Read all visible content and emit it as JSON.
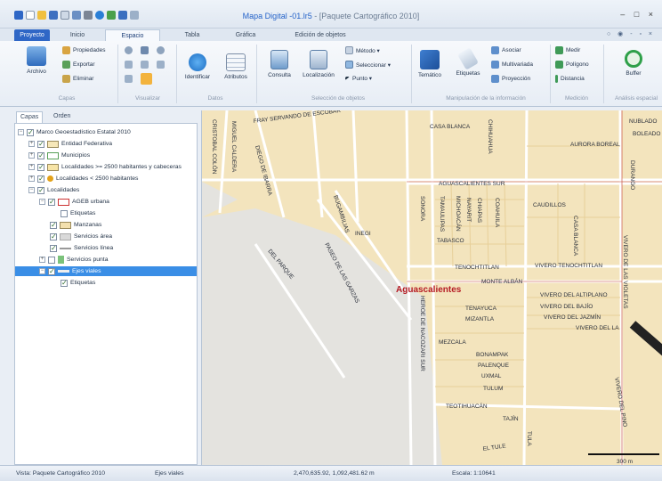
{
  "window": {
    "title": "Mapa Digital -01.lr5",
    "title_suffix": "- [Paquete Cartográfico 2010]",
    "controls": "– □ ×"
  },
  "tabs": [
    "Proyecto",
    "Inicio",
    "Espacio",
    "Tabla",
    "Gráfica",
    "Edición de objetos"
  ],
  "tab_right": "○ ◉ - ▫ ×",
  "ribbon": {
    "archivo": "Archivo",
    "capas_items": [
      "Propiedades",
      "Exportar",
      "Eliminar"
    ],
    "capas_label": "Capas",
    "visualizar_label": "Visualizar",
    "identificar": "Identificar",
    "atributos": "Atributos",
    "datos_label": "Datos",
    "consulta": "Consulta",
    "localizacion": "Localización",
    "metodo": "Método ▾",
    "seleccionar": "Seleccionar ▾",
    "punto": "Punto ▾",
    "seleccion_label": "Selección de objetos",
    "tematico": "Temático",
    "etiquetas": "Etiquetas",
    "asociar": "Asociar",
    "multivariada": "Multivariada",
    "proyeccion": "Proyección",
    "manip_label": "Manipulación de la información",
    "medir": "Medir",
    "poligono": "Polígono",
    "distancia": "Distancia",
    "medicion_label": "Medición",
    "buffer": "Buffer",
    "analisis_label": "Análisis espacial"
  },
  "left_panel": {
    "tabs": [
      "Capas",
      "Orden"
    ],
    "tree": [
      {
        "label": "Marco Geoestadístico Estatal 2010",
        "checked": true
      },
      {
        "label": "Entidad Federativa",
        "checked": true
      },
      {
        "label": "Municipios",
        "checked": true
      },
      {
        "label": "Localidades >= 2500 habitantes y cabeceras",
        "checked": true
      },
      {
        "label": "Localidades < 2500 habitantes",
        "checked": true
      },
      {
        "label": "Localidades",
        "checked": true
      },
      {
        "label": "AGEB urbana",
        "checked": true
      },
      {
        "label": "Etiquetas",
        "checked": false
      },
      {
        "label": "Manzanas",
        "checked": true
      },
      {
        "label": "Servicios área",
        "checked": true
      },
      {
        "label": "Servicios línea",
        "checked": true
      },
      {
        "label": "Servicios punta",
        "checked": false
      },
      {
        "label": "Ejes viales",
        "checked": true
      },
      {
        "label": "Etiquetas",
        "checked": true
      }
    ]
  },
  "map": {
    "city_label": "Aguascalientes",
    "streets": [
      "FRAY SERVANDO DE ESCOBAR",
      "CASA BLANCA",
      "AURORA BOREAL",
      "NUBLADO",
      "BOLEADO",
      "CRISTOBAL COLÓN",
      "MIGUEL CALDERA",
      "DIEGO DE IBARRA",
      "CHIHUAHUA",
      "AGUASCALIENTES SUR",
      "CAUDILLOS",
      "CASA BLANCA",
      "DURANGO",
      "SONORA",
      "TAMAULIPAS",
      "MICHOACÁN",
      "NAYARIT",
      "CHIAPAS",
      "COAHUILA",
      "TABASCO",
      "INEGI",
      "BUGAMBILIAS",
      "PASEO DE LAS GARZAS",
      "TENOCHTITLAN",
      "VIVERO TENOCHTITLAN",
      "MONTE ALBÁN",
      "VIVERO DEL ALTIPLANO",
      "VIVERO DEL BAJÍO",
      "VIVERO DEL JAZMÍN",
      "VIVERO DEL LA",
      "TENAYUCA",
      "MIZANTLA",
      "MEZCALA",
      "BONAMPAK",
      "PALENQUE",
      "UXMAL",
      "TULUM",
      "TEOTIHUACÁN",
      "TAJÍN",
      "EL TULE",
      "TULA",
      "DEL PARQUE",
      "HEROE DE NACOZARI SUR",
      "VIVERO DEL PINO",
      "VIVERO DE LAS VIOLETAS"
    ],
    "scale_bar": "300 m"
  },
  "status": {
    "vista": "Vista: Paquete Cartográfico 2010",
    "layer": "Ejes viales",
    "coords": "2,470,635.92, 1,092,481.62 m",
    "escala": "Escala: 1:10641"
  }
}
